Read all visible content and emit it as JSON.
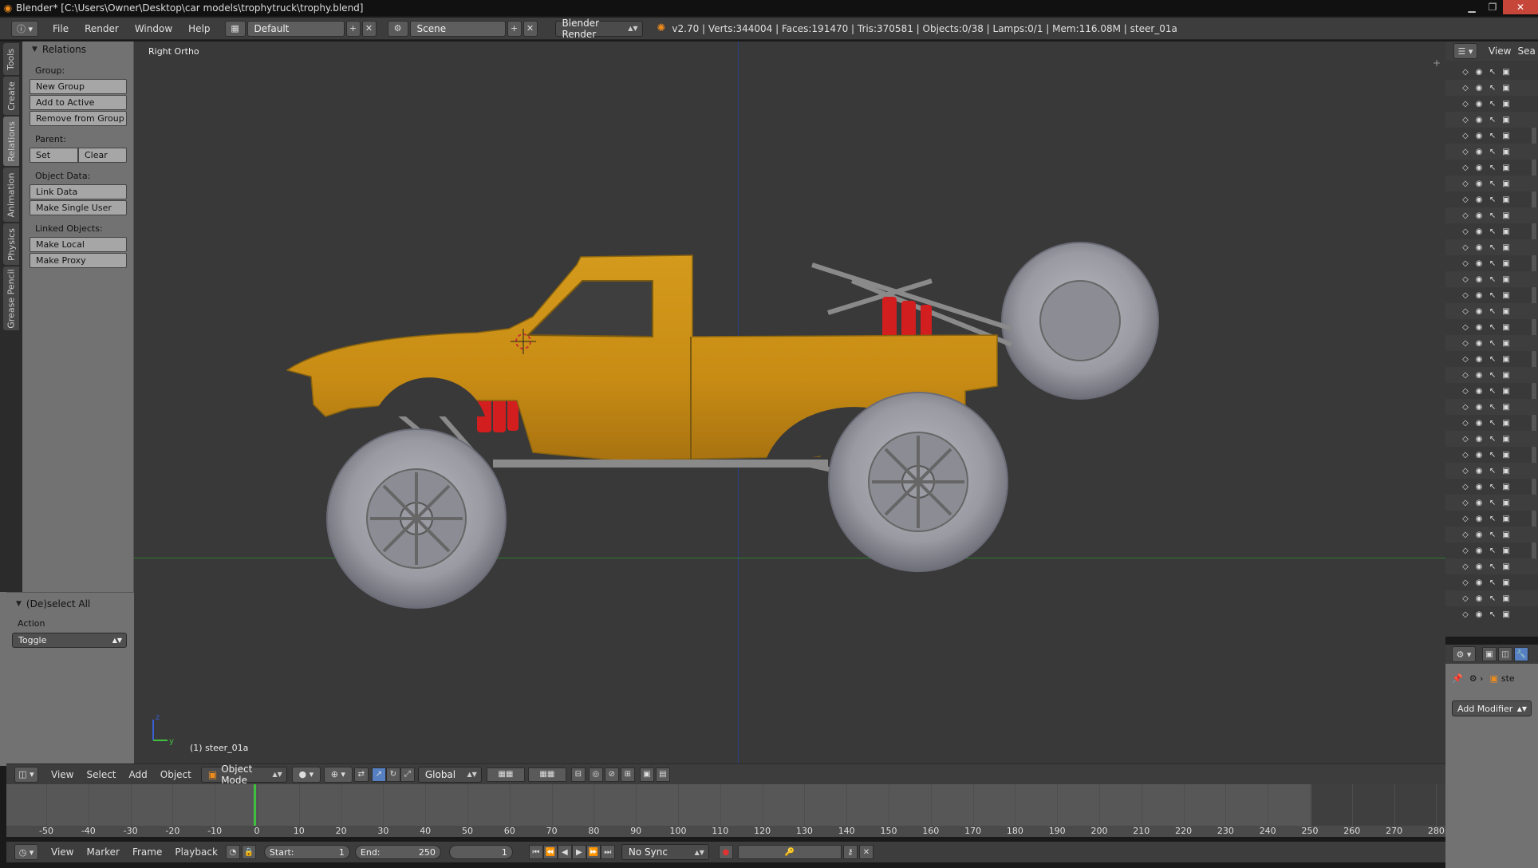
{
  "titlebar": {
    "title": "Blender* [C:\\Users\\Owner\\Desktop\\car models\\trophytruck\\trophy.blend]"
  },
  "info_header": {
    "menus": [
      "File",
      "Render",
      "Window",
      "Help"
    ],
    "screen_layout": "Default",
    "scene": "Scene",
    "render_engine": "Blender Render",
    "stats": "v2.70 | Verts:344004 | Faces:191470 | Tris:370581 | Objects:0/38 | Lamps:0/1 | Mem:116.08M | steer_01a"
  },
  "tabs": [
    "Tools",
    "Create",
    "Relations",
    "Animation",
    "Physics",
    "Grease Pencil"
  ],
  "active_tab": "Relations",
  "relations_panel": {
    "title": "Relations",
    "group_label": "Group:",
    "new_group": "New Group",
    "add_to_active": "Add to Active",
    "remove_from_group": "Remove from Group",
    "parent_label": "Parent:",
    "set": "Set",
    "clear": "Clear",
    "object_data_label": "Object Data:",
    "link_data": "Link Data",
    "make_single_user": "Make Single User",
    "linked_objects_label": "Linked Objects:",
    "make_local": "Make Local",
    "make_proxy": "Make Proxy"
  },
  "redo_panel": {
    "title": "(De)select All",
    "action_label": "Action",
    "action_value": "Toggle"
  },
  "viewport": {
    "view_name": "Right Ortho",
    "active_object": "(1) steer_01a"
  },
  "viewport_header": {
    "menus": [
      "View",
      "Select",
      "Add",
      "Object"
    ],
    "mode": "Object Mode",
    "orientation": "Global"
  },
  "timeline": {
    "ticks": [
      "-50",
      "-40",
      "-30",
      "-20",
      "-10",
      "0",
      "10",
      "20",
      "30",
      "40",
      "50",
      "60",
      "70",
      "80",
      "90",
      "100",
      "110",
      "120",
      "130",
      "140",
      "150",
      "160",
      "170",
      "180",
      "190",
      "200",
      "210",
      "220",
      "230",
      "240",
      "250",
      "260",
      "270",
      "280"
    ],
    "current_frame": 1
  },
  "timeline_header": {
    "menus": [
      "View",
      "Marker",
      "Frame",
      "Playback"
    ],
    "start_label": "Start:",
    "start_value": "1",
    "end_label": "End:",
    "end_value": "250",
    "current_frame": "1",
    "sync": "No Sync"
  },
  "outliner": {
    "header_view": "View",
    "header_search": "Sea"
  },
  "properties": {
    "object_name": "ste",
    "add_modifier": "Add Modifier"
  },
  "colors": {
    "truck_body": "#c88c14",
    "shock": "#d21e1e",
    "tire": "#9a9aa2",
    "frame": "#8a8a8a",
    "axis_vertical": "#2a3f8c",
    "axis_horizontal": "#2d7a2d",
    "frame_cursor": "#3fc13f"
  }
}
